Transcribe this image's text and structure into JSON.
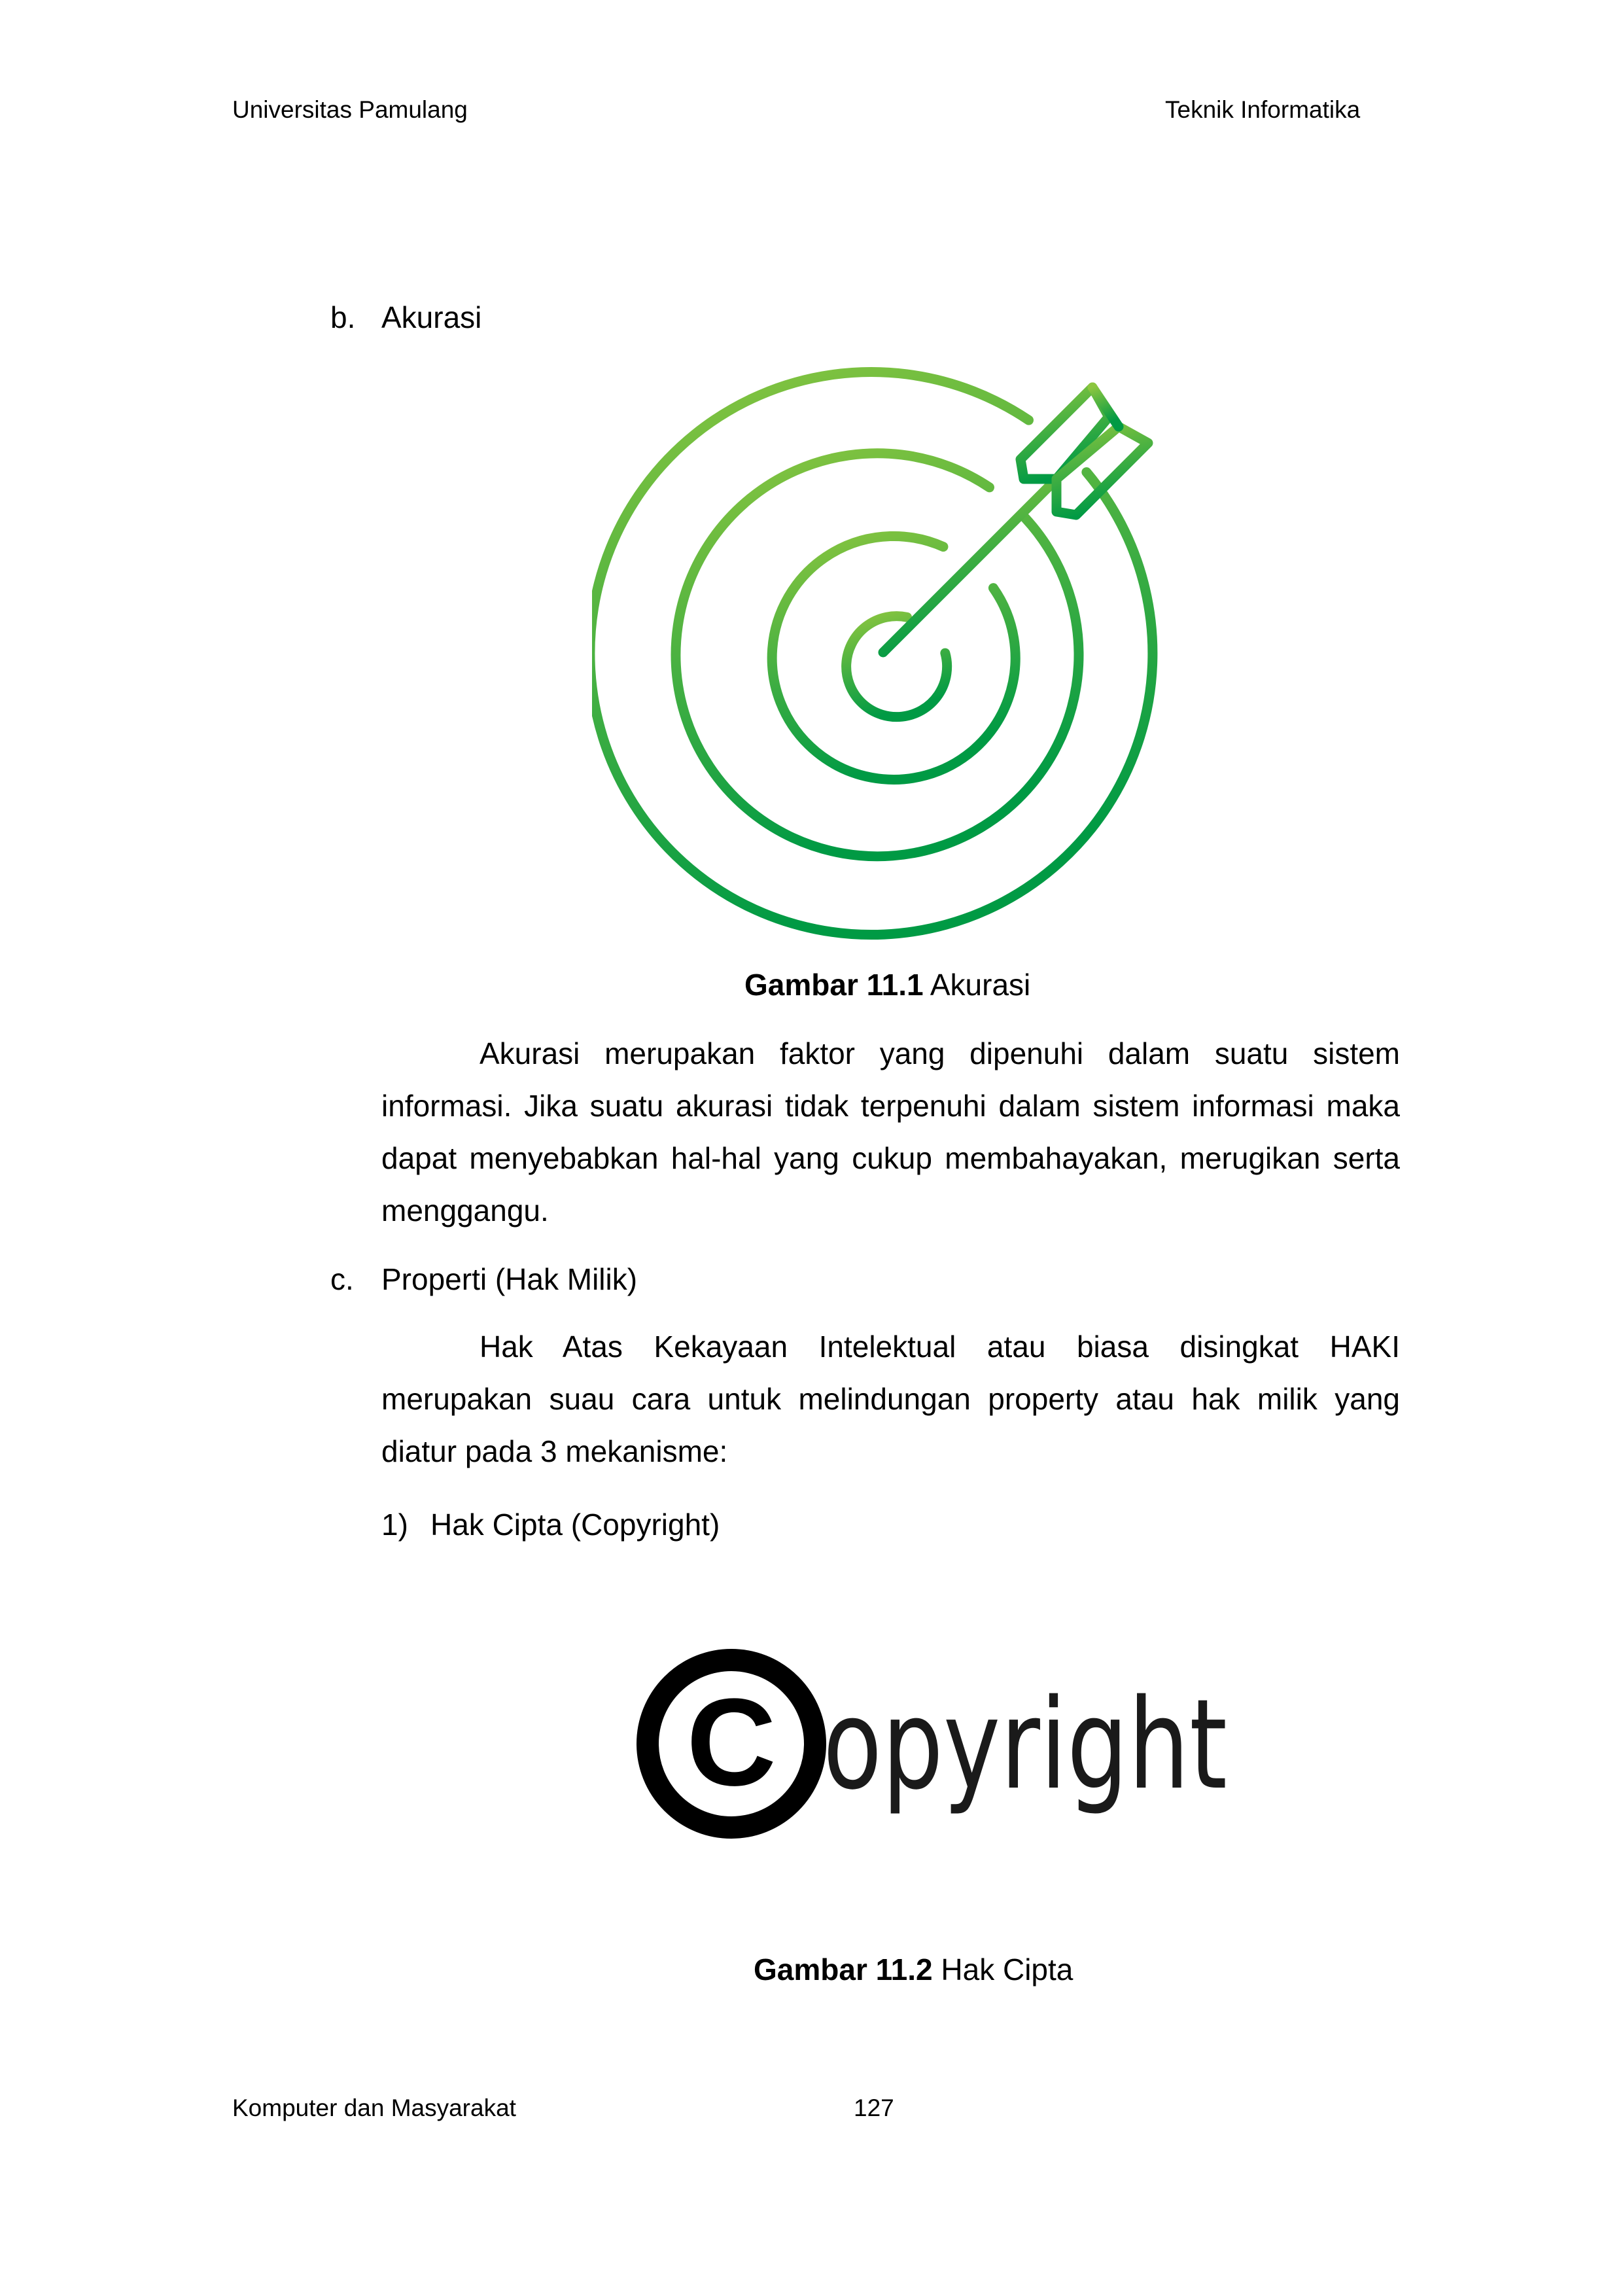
{
  "header": {
    "left": "Universitas Pamulang",
    "right": "Teknik Informatika"
  },
  "section_b": {
    "marker": "b.",
    "title": "Akurasi"
  },
  "figure_1": {
    "label": "Gambar 11.1",
    "title": "Akurasi",
    "icon": "target-arrow-icon",
    "color_light": "#8cc63f",
    "color_dark": "#009a44"
  },
  "paragraph_1": {
    "lines": [
      "Akurasi merupakan faktor yang dipenuhi dalam suatu sistem",
      "informasi. Jika suatu akurasi tidak terpenuhi dalam sistem informasi maka",
      "dapat menyebabkan hal-hal yang cukup membahayakan, merugikan serta",
      "menggangu."
    ]
  },
  "section_c": {
    "marker": "c.",
    "title": "Properti (Hak Milik)"
  },
  "paragraph_2": {
    "lines": [
      "Hak Atas Kekayaan Intelektual  atau biasa disingkat HAKI",
      "merupakan suau cara untuk melindungan property atau hak milik yang",
      "diatur pada 3 mekanisme:"
    ]
  },
  "list_item_1": {
    "marker": "1)",
    "text": "Hak Cipta (Copyright)"
  },
  "figure_2": {
    "label": "Gambar 11.2",
    "title": "Hak Cipta",
    "logo_text": "opyright",
    "icon": "copyright-logo-icon"
  },
  "footer": {
    "left": "Komputer dan Masyarakat",
    "page_number": "127"
  }
}
